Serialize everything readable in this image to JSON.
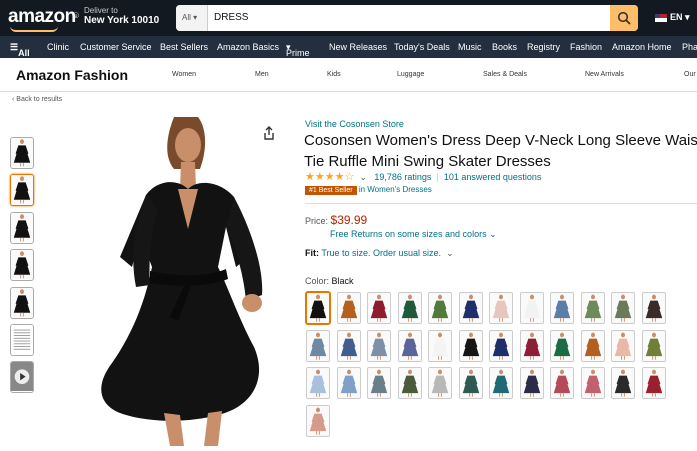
{
  "header": {
    "logo": "amazon",
    "deliver_to": "Deliver to",
    "location": "New York 10010",
    "search_category": "All",
    "search_value": "DRESS",
    "language": "EN"
  },
  "nav": {
    "all": "All",
    "items": [
      "Clinic",
      "Customer Service",
      "Best Sellers",
      "Amazon Basics",
      "Prime",
      "New Releases",
      "Today's Deals",
      "Music",
      "Books",
      "Registry",
      "Fashion",
      "Amazon Home",
      "Pha"
    ]
  },
  "subnav": {
    "brand": "Amazon Fashion",
    "items": [
      "Women",
      "Men",
      "Kids",
      "Luggage",
      "Sales & Deals",
      "New Arrivals",
      "Our"
    ]
  },
  "back": "‹ Back to results",
  "product": {
    "store": "Visit the Cosonsen Store",
    "title_line1": "Cosonsen Women's Dress Deep V-Neck Long Sleeve Waist",
    "title_line2": "Tie Ruffle Mini Swing Skater Dresses",
    "rating_stars": 4.2,
    "ratings": "19,786 ratings",
    "answered": "101 answered questions",
    "badge": "#1 Best Seller",
    "badge_category": "in Women's Dresses",
    "price_label": "Price:",
    "price": "$39.99",
    "returns": "Free Returns on some sizes and colors",
    "fit_label": "Fit:",
    "fit_text": "True to size. Order usual size.",
    "color_label": "Color:",
    "color_value": "Black"
  },
  "thumbnails": [
    "#111111",
    "#111111",
    "#111111",
    "#111111",
    "#111111",
    "chart",
    "video"
  ],
  "swatches": [
    "#111111",
    "#b5611d",
    "#8e1c2c",
    "#1f5b3b",
    "#4f7a3c",
    "#1f2f6b",
    "#e8c6c0",
    "#f2f2f2",
    "#5a7ea8",
    "#6d8a5a",
    "#6b7b5a",
    "#3a2a2a",
    "#6f89a3",
    "#425b91",
    "#7f8fa8",
    "#59659a",
    "#f4f4f4",
    "#151515",
    "#1d2e6b",
    "#8d1e35",
    "#1b6b45",
    "#b35f1f",
    "#e9b8a8",
    "#6f7f3a",
    "#a8c0de",
    "#7fa0c8",
    "#6a7f8a",
    "#4a5a3a",
    "#b8b8b8",
    "#2e5a52",
    "#1f6a74",
    "#2c2c48",
    "#b44a5a",
    "#c06070",
    "#2a2a2a",
    "#9a2030",
    "#d49a8a"
  ]
}
